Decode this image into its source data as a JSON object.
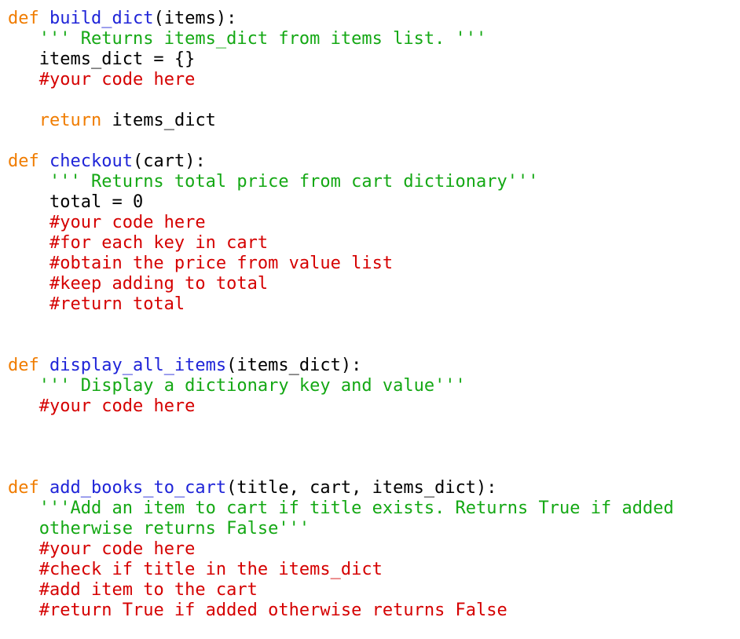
{
  "colors": {
    "keyword": "#f07c00",
    "function": "#1f24d8",
    "string": "#14a814",
    "comment": "#d50000",
    "text": "#000000",
    "background": "#ffffff"
  },
  "lines": [
    [
      {
        "t": "kw",
        "v": "def"
      },
      {
        "t": "plain",
        "v": " "
      },
      {
        "t": "fn",
        "v": "build_dict"
      },
      {
        "t": "plain",
        "v": "(items):"
      }
    ],
    [
      {
        "t": "plain",
        "v": "   "
      },
      {
        "t": "str",
        "v": "''' Returns items_dict from items list. '''"
      }
    ],
    [
      {
        "t": "plain",
        "v": "   items_dict = {}"
      }
    ],
    [
      {
        "t": "plain",
        "v": "   "
      },
      {
        "t": "cmt",
        "v": "#your code here"
      }
    ],
    [],
    [
      {
        "t": "plain",
        "v": "   "
      },
      {
        "t": "kw",
        "v": "return"
      },
      {
        "t": "plain",
        "v": " items_dict"
      }
    ],
    [],
    [
      {
        "t": "kw",
        "v": "def"
      },
      {
        "t": "plain",
        "v": " "
      },
      {
        "t": "fn",
        "v": "checkout"
      },
      {
        "t": "plain",
        "v": "(cart):"
      }
    ],
    [
      {
        "t": "plain",
        "v": "    "
      },
      {
        "t": "str",
        "v": "''' Returns total price from cart dictionary'''"
      }
    ],
    [
      {
        "t": "plain",
        "v": "    total = 0"
      }
    ],
    [
      {
        "t": "plain",
        "v": "    "
      },
      {
        "t": "cmt",
        "v": "#your code here"
      }
    ],
    [
      {
        "t": "plain",
        "v": "    "
      },
      {
        "t": "cmt",
        "v": "#for each key in cart"
      }
    ],
    [
      {
        "t": "plain",
        "v": "    "
      },
      {
        "t": "cmt",
        "v": "#obtain the price from value list"
      }
    ],
    [
      {
        "t": "plain",
        "v": "    "
      },
      {
        "t": "cmt",
        "v": "#keep adding to total"
      }
    ],
    [
      {
        "t": "plain",
        "v": "    "
      },
      {
        "t": "cmt",
        "v": "#return total"
      }
    ],
    [],
    [],
    [
      {
        "t": "kw",
        "v": "def"
      },
      {
        "t": "plain",
        "v": " "
      },
      {
        "t": "fn",
        "v": "display_all_items"
      },
      {
        "t": "plain",
        "v": "(items_dict):"
      }
    ],
    [
      {
        "t": "plain",
        "v": "   "
      },
      {
        "t": "str",
        "v": "''' Display a dictionary key and value'''"
      }
    ],
    [
      {
        "t": "plain",
        "v": "   "
      },
      {
        "t": "cmt",
        "v": "#your code here"
      }
    ],
    [],
    [],
    [],
    [
      {
        "t": "kw",
        "v": "def"
      },
      {
        "t": "plain",
        "v": " "
      },
      {
        "t": "fn",
        "v": "add_books_to_cart"
      },
      {
        "t": "plain",
        "v": "(title, cart, items_dict):"
      }
    ],
    [
      {
        "t": "plain",
        "v": "   "
      },
      {
        "t": "str",
        "v": "'''Add an item to cart if title exists. Returns True if added"
      }
    ],
    [
      {
        "t": "plain",
        "v": "   "
      },
      {
        "t": "str",
        "v": "otherwise returns False'''"
      }
    ],
    [
      {
        "t": "plain",
        "v": "   "
      },
      {
        "t": "cmt",
        "v": "#your code here"
      }
    ],
    [
      {
        "t": "plain",
        "v": "   "
      },
      {
        "t": "cmt",
        "v": "#check if title in the items_dict"
      }
    ],
    [
      {
        "t": "plain",
        "v": "   "
      },
      {
        "t": "cmt",
        "v": "#add item to the cart"
      }
    ],
    [
      {
        "t": "plain",
        "v": "   "
      },
      {
        "t": "cmt",
        "v": "#return True if added otherwise returns False"
      }
    ]
  ]
}
